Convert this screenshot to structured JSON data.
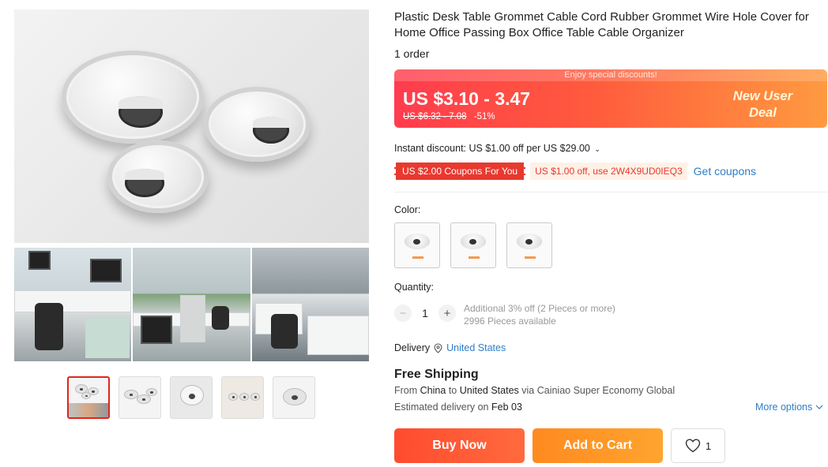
{
  "product": {
    "title": "Plastic Desk Table Grommet Cable Cord Rubber Grommet Wire Hole Cover for Home Office Passing Box Office Table Cable Organizer",
    "orders": "1 order"
  },
  "price": {
    "banner": "Enjoy special discounts!",
    "current": "US $3.10 - 3.47",
    "original": "US $6.32 - 7.08",
    "discount": "-51%",
    "promo_line1": "New User",
    "promo_line2": "Deal"
  },
  "coupons": {
    "instant_discount": "Instant discount: US $1.00 off per US $29.00",
    "coupon_badge": "US $2.00 Coupons For You",
    "coupon_code": "US $1.00 off, use 2W4X9UD0IEQ3",
    "get_coupons": "Get coupons"
  },
  "color": {
    "label": "Color:",
    "options_count": 3
  },
  "quantity": {
    "label": "Quantity:",
    "minus": "−",
    "value": "1",
    "plus": "+",
    "additional": "Additional 3% off (2 Pieces or more)",
    "available": "2996 Pieces available"
  },
  "delivery": {
    "label": "Delivery",
    "country": "United States"
  },
  "shipping": {
    "title": "Free Shipping",
    "from_prefix": "From",
    "from_country": "China",
    "to_word": "to",
    "to_country": "United States",
    "via": "via Cainiao Super Economy Global",
    "est_prefix": "Estimated delivery on",
    "est_date": "Feb 03",
    "more_options": "More options"
  },
  "actions": {
    "buy_now": "Buy Now",
    "add_to_cart": "Add to Cart",
    "wishlist_count": "1"
  },
  "colors": {
    "accent_red": "#e1251b",
    "link_blue": "#2f7dc8",
    "buy_now": "#ff4b2f",
    "add_to_cart": "#ff9a2a"
  }
}
